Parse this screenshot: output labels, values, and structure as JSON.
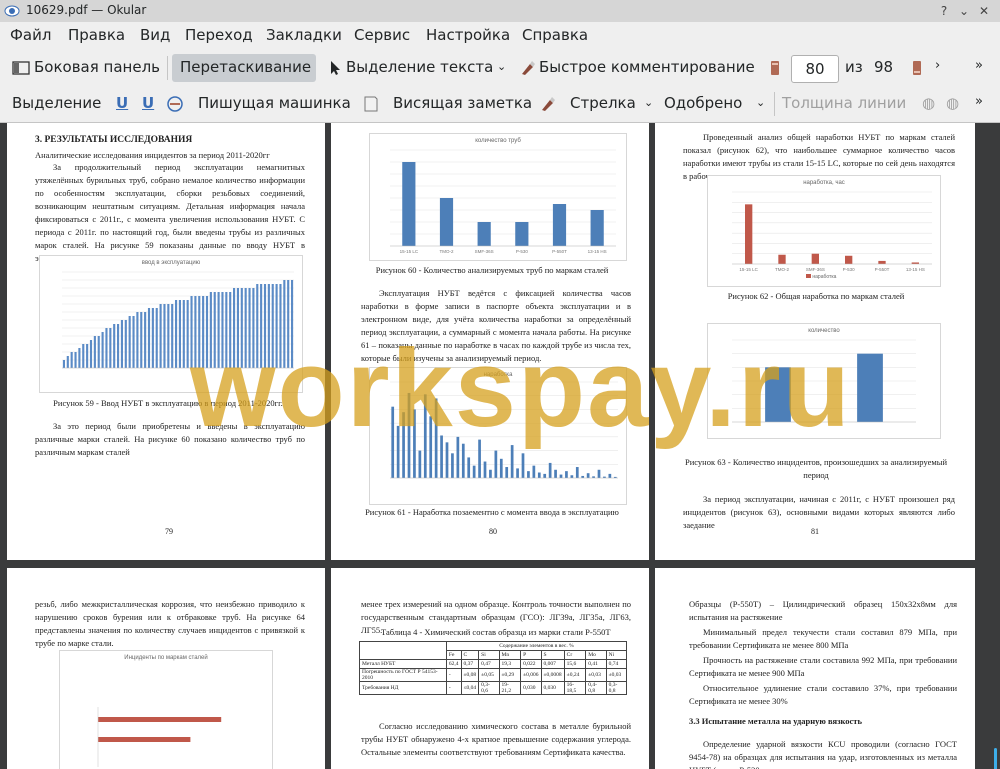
{
  "window": {
    "title": "10629.pdf — Okular"
  },
  "menu": [
    "Файл",
    "Правка",
    "Вид",
    "Переход",
    "Закладки",
    "Сервис",
    "Настройка",
    "Справка"
  ],
  "toolbar1": {
    "sidebar": "Боковая панель",
    "drag": "Перетаскивание",
    "text_select": "Выделение текста",
    "quick_comment": "Быстрое комментирование",
    "page_current": "80",
    "page_of": "из",
    "page_total": "98"
  },
  "toolbar2": {
    "select": "Выделение",
    "typewriter": "Пишущая машинка",
    "sticky": "Висящая заметка",
    "arrow": "Стрелка",
    "approved": "Одобрено",
    "line_width": "Толщина линии"
  },
  "watermark": "workspay.ru",
  "pages": {
    "p79": {
      "heading": "3. РЕЗУЛЬТАТЫ ИССЛЕДОВАНИЯ",
      "subheading": "Аналитические исследования инцидентов за период 2011-2020гг",
      "para1": "За продолжительный период эксплуатации немагнитных утяжелённых бурильных труб, собрано немалое количество информации по особенностям эксплуатации, сборки резьбовых соединений, возникающим нештатным ситуациям. Детальная информация начала фиксироваться с 2011г., с момента увеличения использования НУБТ. С периода с 2011г. по настоящий год, были введены трубы из различных марок сталей. На рисунке 59 показаны данные по вводу НУБТ в эксплуатацию начиная с 2011г.",
      "chart_title": "ввод в эксплуатацию",
      "caption": "Рисунок 59 - Ввод НУБТ в эксплуатацию в период 2011-2020гг.",
      "para2": "За это период были приобретены и введены в эксплуатацию различные марки сталей. На рисунке 60 показано количество труб по различным маркам сталей",
      "number": "79"
    },
    "p80": {
      "chart_title": "количество труб",
      "caption1": "Рисунок 60 - Количество анализируемых труб по маркам сталей",
      "para": "Эксплуатация НУБТ ведётся с фиксацией количества часов наработки в форме записи в паспорте объекта эксплуатации и в электронном виде, для учёта количества наработки за определённый период эксплуатации, а суммарный с момента начала работы. На рисунке 61 – показаны данные по наработке в часах по каждой трубе из числа тех, которые были изучены за анализируемый период.",
      "chart2_title": "наработка",
      "caption2": "Рисунок 61 - Наработка позаементно с момента ввода в эксплуатацию",
      "number": "80"
    },
    "p81": {
      "para1": "Проведенный анализ общей наработки НУБТ по маркам сталей показал (рисунок 62), что наибольшее суммарное количество часов наработки имеют трубы из стали 15-15 LC, которые по сей день находятся в рабочем состоянии",
      "chart_title": "наработка, час",
      "legend": "наработка",
      "caption1": "Рисунок 62 - Общая наработка по маркам сталей",
      "chart2_title": "количество",
      "caption2": "Рисунок 63 - Количество инцидентов, произошедших за анализируемый период",
      "para2": "За период эксплуатации, начиная с 2011г, с НУБТ произошел ряд инцидентов (рисунок 63), основными видами которых являются либо заедание",
      "number": "81"
    },
    "p82": {
      "para": "резьб, либо межкристаллическая коррозия, что неизбежно приводило к нарушению сроков бурения или к отбраковке труб. На рисунке 64 представлены значения по количеству случаев инцидентов с привязкой к трубе по марке стали.",
      "chart_title": "Инциденты по маркам сталей"
    },
    "p83": {
      "para1": "менее трех измерений на одном образце. Контроль точности выполнен по государственным стандартным образцам (ГСО): ЛГ39а, ЛГ35а, ЛГ63, ЛГ55.",
      "table_caption": "Таблица 4 - Химический состав образца из марки стали Р-550Т",
      "table_header": "Содержание элементов в вес. %",
      "table_cols": [
        "Fe",
        "C",
        "Si",
        "Mn",
        "P",
        "S",
        "Cr",
        "Mo",
        "Ni"
      ],
      "table_rows": [
        [
          "Металл НУБТ",
          "62,4",
          "0,37",
          "0,47",
          "19,3",
          "0,022",
          "0,007",
          "15,6",
          "0,41",
          "0,74"
        ],
        [
          "Погрешность по ГОСТ Р 54153-2010",
          "-",
          "±0,08",
          "±0,05",
          "±0,29",
          "±0,006",
          "±0,0008",
          "±0,24",
          "±0,03",
          "±0,03"
        ],
        [
          "Требования НД",
          "-",
          "≤0,04",
          "0,3-0,6",
          "19-21,2",
          "0,030",
          "0,030",
          "16-18,5",
          "0,4-0,8",
          "0,3-0,8"
        ]
      ],
      "para2": "Согласно исследованию химического состава в металле бурильной трубы НУБТ обнаружено 4-х кратное превышение содержания углерода. Остальные элементы соответствуют требованиям Сертификата качества."
    },
    "p84": {
      "para1": "Образцы (Р-550Т) – Цилиндрический образец 150х32х8мм для испытания на растяжение",
      "para2": "Минимальный предел текучести стали составил 879 МПа, при требовании Сертификата не менее 800 МПа",
      "para3": "Прочность на растяжение стали составила 992 МПа, при требовании Сертификата не менее 900 МПа",
      "para4": "Относительное удлинение стали составило 37%, при требовании Сертификата не менее 30%",
      "heading": "3.3 Испытание металла на ударную вязкость",
      "para5": "Определение ударной вязкости КCU проводили (согласно ГОСТ 9454-78) на образцах для испытания на удар, изготовленных из металла НУБТ (марка Р-530 и"
    }
  },
  "chart_data": [
    {
      "type": "bar",
      "title": "количество труб",
      "categories": [
        "15-15 LC",
        "TMO-2",
        "SMF-36S",
        "P-530",
        "P-550T",
        "13-15 HS"
      ],
      "values": [
        14,
        8,
        4,
        4,
        7,
        6
      ],
      "ylim": [
        0,
        16
      ]
    },
    {
      "type": "bar",
      "title": "наработка, час",
      "categories": [
        "15-15 LC",
        "TMO-2",
        "SMF-36S",
        "P-530",
        "P-550T",
        "13-15 HS"
      ],
      "values": [
        58000,
        9000,
        10000,
        8000,
        3000,
        1500
      ],
      "ylim": [
        0,
        70000
      ],
      "legend": "наработка"
    },
    {
      "type": "bar",
      "title": "количество",
      "values": [
        8,
        10
      ],
      "ylim": [
        0,
        12
      ]
    },
    {
      "type": "bar",
      "title": "наработка",
      "values": [
        5200,
        3800,
        4800,
        6200,
        5000,
        2000,
        6100,
        4500,
        5800,
        3100,
        2600,
        1800,
        3000,
        2500,
        1500,
        900,
        2800,
        1200,
        600,
        2000,
        1400,
        800,
        2400,
        700,
        1800,
        500,
        900,
        400,
        300,
        1100,
        600,
        250,
        500,
        200,
        800,
        150,
        350,
        120,
        600,
        100,
        300,
        80
      ],
      "ylim": [
        0,
        7000
      ]
    },
    {
      "type": "bar",
      "title": "ввод в эксплуатацию",
      "values": [
        2,
        3,
        4,
        4,
        5,
        6,
        6,
        7,
        8,
        8,
        9,
        10,
        10,
        11,
        11,
        12,
        12,
        13,
        13,
        14,
        14,
        14,
        15,
        15,
        15,
        16,
        16,
        16,
        16,
        17,
        17,
        17,
        17,
        18,
        18,
        18,
        18,
        18,
        19,
        19,
        19,
        19,
        19,
        19,
        20,
        20,
        20,
        20,
        20,
        20,
        21,
        21,
        21,
        21,
        21,
        21,
        21,
        22,
        22,
        22
      ],
      "ylim": [
        0,
        24
      ]
    },
    {
      "type": "bar",
      "title": "Инциденты по маркам сталей",
      "values": [
        4,
        3
      ],
      "ylim": [
        0,
        5
      ]
    }
  ]
}
